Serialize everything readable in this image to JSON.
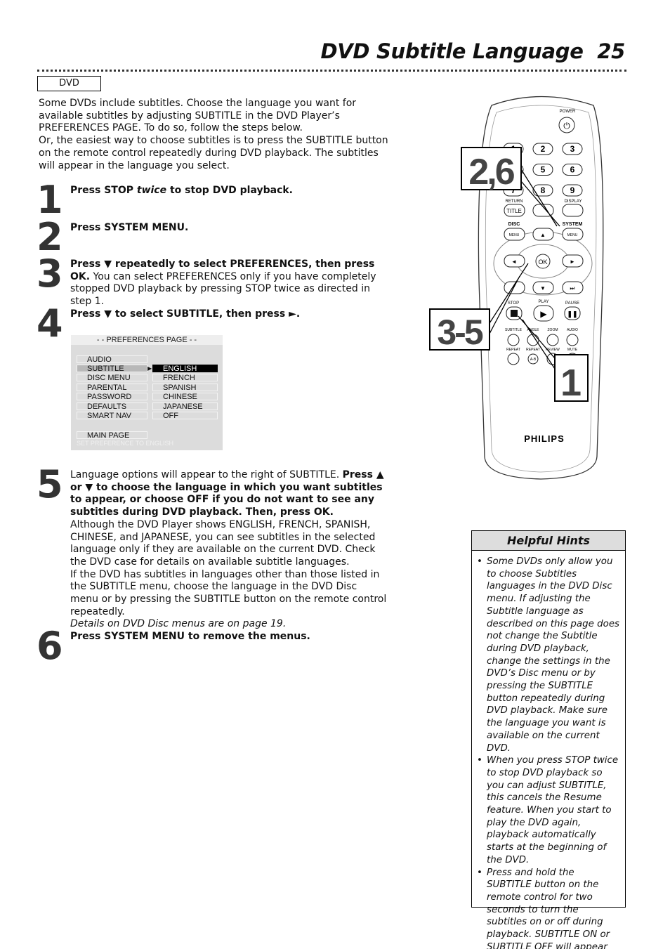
{
  "header": {
    "title": "DVD Subtitle Language",
    "page_number": "25",
    "tag": "DVD"
  },
  "intro": [
    "Some DVDs include subtitles. Choose the language you want for available subtitles by adjusting SUBTITLE in the DVD Player’s PREFERENCES PAGE. To do so, follow the steps below.",
    "Or, the easiest way to choose subtitles is to press the SUBTITLE button on the remote control repeatedly during DVD playback. The subtitles will appear in the language you select."
  ],
  "steps": [
    {
      "num": "1",
      "a": "Press STOP ",
      "b": "twice",
      "c": " to stop DVD playback."
    },
    {
      "num": "2",
      "a": "Press SYSTEM MENU."
    },
    {
      "num": "3",
      "a": "Press ▼ repeatedly to select PREFERENCES, then press OK.",
      "b": " You can select PREFERENCES only if you have completely stopped DVD playback by pressing STOP twice as directed in step 1."
    },
    {
      "num": "4",
      "a": "Press ▼ to select SUBTITLE, then press ►."
    },
    {
      "num": "5",
      "a": "Language options will appear to the right of SUBTITLE. ",
      "b": "Press ▲ or ▼ to choose the language in which you want subtitles to appear, or choose OFF if you do not want to see any subtitles during DVD playback. Then, press OK.",
      "c": "Although the DVD Player shows ENGLISH, FRENCH, SPANISH, CHINESE, and JAPANESE, you can see subtitles in the selected language only if they are available on the current DVD. Check the DVD case for details on available subtitle languages.",
      "d": "If the DVD has subtitles in languages other than those listed in the SUBTITLE menu, choose the language in the DVD Disc menu or by pressing the SUBTITLE button on the remote control repeatedly.",
      "e": "Details on DVD Disc menus are on page 19."
    },
    {
      "num": "6",
      "a": "Press SYSTEM MENU to remove the menus."
    }
  ],
  "osd": {
    "title": "- -  PREFERENCES PAGE  - -",
    "left": [
      "AUDIO",
      "SUBTITLE",
      "DISC MENU",
      "PARENTAL",
      "PASSWORD",
      "DEFAULTS",
      "SMART NAV"
    ],
    "right": [
      "ENGLISH",
      "FRENCH",
      "SPANISH",
      "CHINESE",
      "JAPANESE",
      "OFF"
    ],
    "selected_left": "SUBTITLE",
    "selected_right": "ENGLISH",
    "main": "MAIN PAGE",
    "status": "SET PREFERENCE TO ENGLISH"
  },
  "remote": {
    "brand": "PHILIPS",
    "power": "POWER",
    "digits": [
      "1",
      "2",
      "3",
      "4",
      "5",
      "6",
      "7",
      "8",
      "9"
    ],
    "return": "RETURN",
    "title": "TITLE",
    "display": "DISPLAY",
    "disc": "DISC",
    "system": "SYSTEM",
    "menu": "MENU",
    "ok": "OK",
    "stop": "STOP",
    "play": "PLAY",
    "pause": "PAUSE",
    "subtitle": "SUBTITLE",
    "angle": "ANGLE",
    "zoom": "ZOOM",
    "audio": "AUDIO",
    "repeat": "REPEAT",
    "repeat_ab": "REPEAT",
    "ab": "A-B",
    "review": "REVIEW",
    "mute": "MUTE",
    "callouts": [
      "2,6",
      "3-5",
      "1"
    ]
  },
  "hints": {
    "title": "Helpful Hints",
    "items": [
      "Some DVDs only allow you to choose Subtitles languages in the DVD Disc menu. If adjusting the Subtitle language as described on this page does not change the Subtitle during DVD playback, change the settings in the DVD’s Disc menu or by pressing the SUBTITLE button repeatedly during DVD playback. Make sure the language you want is available on the current DVD.",
      "When you press STOP twice to stop DVD playback so you can adjust SUBTITLE, this cancels the Resume feature. When you start to play the DVD again, playback automatically starts at the beginning of the DVD.",
      "Press and hold the SUBTITLE button on the remote control for two seconds to turn the subtitles on or off during playback. SUBTITLE ON or SUBTITLE OFF will appear briefly in the top left corner of the TV screen."
    ]
  }
}
